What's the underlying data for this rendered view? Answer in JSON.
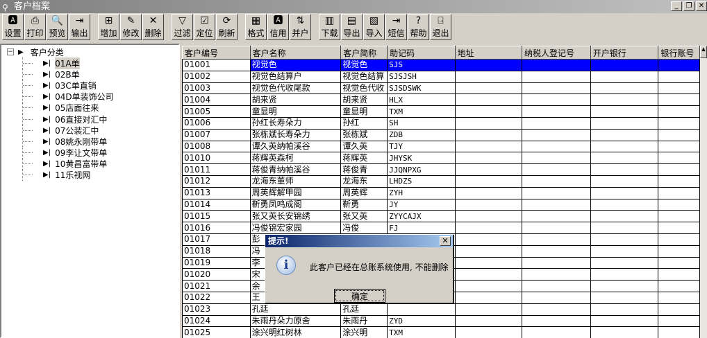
{
  "window": {
    "title": "客户档案",
    "icon": "search-icon"
  },
  "toolbar": [
    [
      {
        "label": "设置",
        "icon": "settings-icon"
      },
      {
        "label": "打印",
        "icon": "printer-icon"
      },
      {
        "label": "预览",
        "icon": "preview-icon"
      },
      {
        "label": "输出",
        "icon": "output-icon"
      }
    ],
    [
      {
        "label": "增加",
        "icon": "add-icon"
      },
      {
        "label": "修改",
        "icon": "edit-icon"
      },
      {
        "label": "删除",
        "icon": "delete-icon"
      }
    ],
    [
      {
        "label": "过滤",
        "icon": "filter-icon"
      },
      {
        "label": "定位",
        "icon": "locate-icon"
      },
      {
        "label": "刷新",
        "icon": "refresh-icon"
      }
    ],
    [
      {
        "label": "格式",
        "icon": "format-icon"
      },
      {
        "label": "信用",
        "icon": "credit-icon"
      },
      {
        "label": "并户",
        "icon": "merge-icon"
      }
    ],
    [
      {
        "label": "下载",
        "icon": "download-icon"
      },
      {
        "label": "导出",
        "icon": "export-icon"
      },
      {
        "label": "导入",
        "icon": "import-icon"
      },
      {
        "label": "短信",
        "icon": "sms-icon"
      },
      {
        "label": "帮助",
        "icon": "help-icon"
      },
      {
        "label": "退出",
        "icon": "exit-icon"
      }
    ]
  ],
  "tree": {
    "root": "客户分类",
    "items": [
      "01A单",
      "02B单",
      "03C单直销",
      "04D单装饰公司",
      "05店面往来",
      "06直接对汇中",
      "07公装汇中",
      "08姚永刚带单",
      "09李让文带单",
      "10黄昌富带单",
      "11乐视网"
    ],
    "selected": 0
  },
  "grid": {
    "columns": [
      "客户编号",
      "客户名称",
      "客户简称",
      "助记码",
      "地址",
      "纳税人登记号",
      "开户银行",
      "银行账号"
    ],
    "rows": [
      [
        "01001",
        "视觉色",
        "视觉色",
        "SJS"
      ],
      [
        "01002",
        "视觉色结算户",
        "视觉色结算",
        "SJSJSH"
      ],
      [
        "01003",
        "视觉色代收尾款",
        "视觉色代收",
        "SJSDSWK"
      ],
      [
        "01004",
        "胡来贤",
        "胡来贤",
        "HLX"
      ],
      [
        "01005",
        "童显明",
        "童显明",
        "TXM"
      ],
      [
        "01006",
        "孙红长寿朵力",
        "孙红",
        "SH"
      ],
      [
        "01007",
        "张栋斌长寿朵力",
        "张栋斌",
        "ZDB"
      ],
      [
        "01008",
        "谭久英纳帕溪谷",
        "谭久英",
        "TJY"
      ],
      [
        "01010",
        "蒋辉英森柯",
        "蒋辉英",
        "JHYSK"
      ],
      [
        "01011",
        "蒋俊青纳帕溪谷",
        "蒋俊青",
        "JJQNPXG"
      ],
      [
        "01012",
        "龙海东董师",
        "龙海东",
        "LHDZS"
      ],
      [
        "01013",
        "周英辉解甲园",
        "周英辉",
        "ZYH"
      ],
      [
        "01014",
        "靳勇凤鸣成阁",
        "靳勇",
        "JY"
      ],
      [
        "01015",
        "张又英长安锦绣",
        "张又英",
        "ZYYCAJX"
      ],
      [
        "01016",
        "冯俊锦宏家园",
        "冯俊",
        "FJ"
      ],
      [
        "01017",
        "彭",
        "",
        ""
      ],
      [
        "01018",
        "冯",
        "",
        ""
      ],
      [
        "01019",
        "李",
        "",
        ""
      ],
      [
        "01020",
        "宋",
        "",
        ""
      ],
      [
        "01021",
        "余",
        "",
        ""
      ],
      [
        "01022",
        "王",
        "",
        ""
      ],
      [
        "01023",
        "孔廷",
        "孔廷",
        ""
      ],
      [
        "01024",
        "朱雨丹朵力原舍",
        "朱雨丹",
        "ZYD"
      ],
      [
        "01025",
        "涂兴明红树林",
        "涂兴明",
        "TXM"
      ]
    ],
    "selected_row": 0,
    "selection_color": "#0000ff"
  },
  "dialog": {
    "title": "提示!",
    "message": "此客户已经在总账系统使用, 不能删除",
    "ok_label": "确定",
    "icon": "info-icon"
  }
}
